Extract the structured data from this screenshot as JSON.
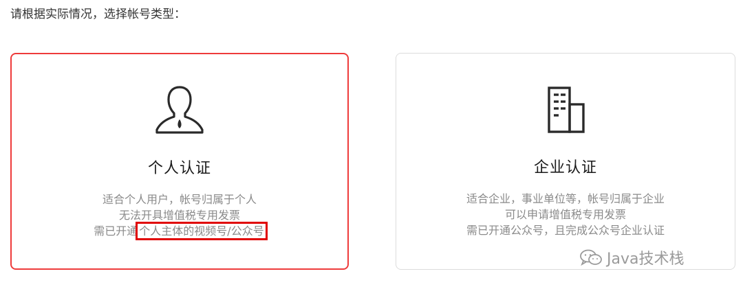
{
  "prompt": "请根据实际情况，选择帐号类型：",
  "cards": [
    {
      "title": "个人认证",
      "icon": "person-icon",
      "desc_line1": "适合个人用户，帐号归属于个人",
      "desc_line2": "无法开具增值税专用发票",
      "desc_line3_prefix": "需已开通",
      "desc_line3_highlight": "个人主体的视频号/公众号",
      "selected": true
    },
    {
      "title": "企业认证",
      "icon": "building-icon",
      "desc_line1": "适合企业，事业单位等，帐号归属于企业",
      "desc_line2": "可以申请增值税专用发票",
      "desc_line3": "需已开通公众号，且完成公众号企业认证",
      "selected": false
    }
  ],
  "watermark": {
    "text": "Java技术栈",
    "icon": "wechat-icon"
  },
  "colors": {
    "selected_border": "#ee3a3a",
    "highlight_box": "#e00000",
    "card_border": "#dcdcdc",
    "desc_text": "#8a8a8a"
  }
}
